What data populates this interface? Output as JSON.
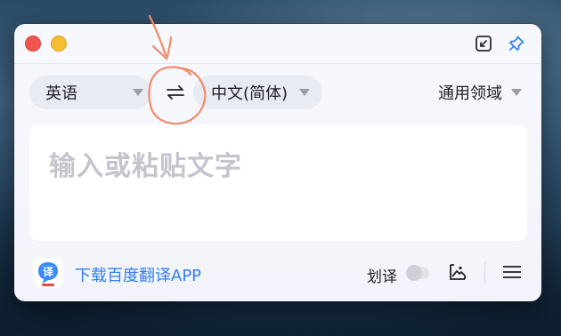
{
  "window": {
    "controls": [
      "close",
      "minimize"
    ]
  },
  "titlebar": {
    "shrink_icon": "shrink-window-icon",
    "pin_icon": "pin-icon",
    "pin_color": "#2f7ef5"
  },
  "language_bar": {
    "source_language": "英语",
    "target_language": "中文(简体)",
    "swap_icon": "swap-arrows-icon",
    "domain": "通用领域"
  },
  "input": {
    "placeholder": "输入或粘贴文字",
    "value": ""
  },
  "footer": {
    "app_logo_glyph": "译",
    "download_label": "下载百度翻译APP",
    "download_color": "#2f7ef5",
    "word_select_label": "划译",
    "word_select_enabled": false,
    "image_icon": "image-translate-icon",
    "menu_icon": "hamburger-menu-icon"
  },
  "annotation": {
    "color": "#f08a6a"
  }
}
